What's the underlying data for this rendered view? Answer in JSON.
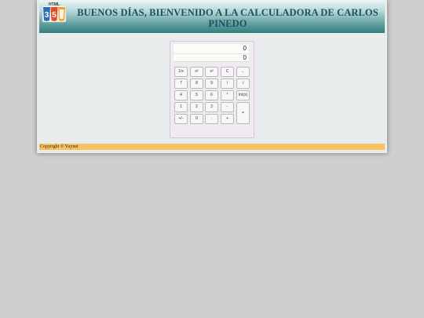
{
  "header": {
    "title": "BUENOS DÍAS, BIENVENIDO A LA CALCULADORA DE CARLOS PINEDO",
    "logo_text": "HTML",
    "logo_digits": [
      "3",
      "5"
    ]
  },
  "calculator": {
    "display_expression": "0",
    "display_result": "0",
    "keys": {
      "reciprocal": "1/x",
      "square": "x²",
      "cube": "x³",
      "clear": "C",
      "backspace": "←",
      "seven": "7",
      "eight": "8",
      "nine": "9",
      "divide": "/",
      "sqrt": "√",
      "four": "4",
      "five": "5",
      "six": "6",
      "multiply": "*",
      "integer": "Int(x)",
      "one": "1",
      "two": "2",
      "three": "3",
      "subtract": "-",
      "equals": "=",
      "negate": "+/-",
      "zero": "0",
      "decimal": ".",
      "add": "+"
    }
  },
  "footer": {
    "copyright": "Copyright © Yuynet"
  },
  "colors": {
    "page_background": "#cfcfcf",
    "header_dark": "#357c7c",
    "title_text": "#1f4f5f",
    "footer_bar": "#f7c362",
    "calculator_body": "#f1eaf3"
  }
}
